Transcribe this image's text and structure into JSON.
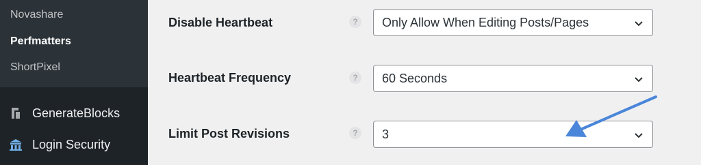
{
  "sidebar": {
    "submenu": [
      {
        "label": "Novashare"
      },
      {
        "label": "Perfmatters"
      },
      {
        "label": "ShortPixel"
      }
    ],
    "menu": [
      {
        "label": "GenerateBlocks",
        "icon": "generateblocks-icon"
      },
      {
        "label": "Login Security",
        "icon": "login-security-icon"
      }
    ]
  },
  "settings": {
    "help_symbol": "?",
    "rows": [
      {
        "label": "Disable Heartbeat",
        "value": "Only Allow When Editing Posts/Pages"
      },
      {
        "label": "Heartbeat Frequency",
        "value": "60 Seconds"
      },
      {
        "label": "Limit Post Revisions",
        "value": "3"
      }
    ]
  },
  "colors": {
    "sidebar_bg": "#1d2327",
    "submenu_bg": "#2c3338",
    "content_bg": "#f0f0f1",
    "annotation_arrow": "#4a86d9"
  }
}
